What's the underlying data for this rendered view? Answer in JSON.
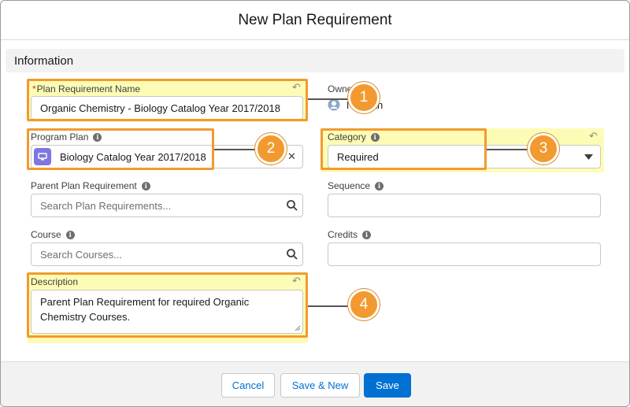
{
  "header": {
    "title": "New Plan Requirement"
  },
  "section": {
    "title": "Information"
  },
  "fields": {
    "plan_requirement_name": {
      "required_marker": "*",
      "label": "Plan Requirement Name",
      "value": "Organic Chemistry - Biology Catalog Year 2017/2018"
    },
    "owner": {
      "label": "Owner",
      "value": "N Smith"
    },
    "program_plan": {
      "label": "Program Plan",
      "value": "Biology Catalog Year 2017/2018",
      "clear_glyph": "✕"
    },
    "category": {
      "label": "Category",
      "value": "Required"
    },
    "parent_plan_requirement": {
      "label": "Parent Plan Requirement",
      "placeholder": "Search Plan Requirements..."
    },
    "sequence": {
      "label": "Sequence",
      "value": ""
    },
    "course": {
      "label": "Course",
      "placeholder": "Search Courses..."
    },
    "credits": {
      "label": "Credits",
      "value": ""
    },
    "description": {
      "label": "Description",
      "value": "Parent Plan Requirement for required Organic Chemistry Courses."
    }
  },
  "callouts": [
    "1",
    "2",
    "3",
    "4"
  ],
  "footer": {
    "cancel": "Cancel",
    "save_new": "Save & New",
    "save": "Save"
  },
  "icons": {
    "info": "i",
    "undo": "↶"
  },
  "colors": {
    "highlight": "#fdfcb6",
    "callout": "#f29a2f",
    "brand": "#0070d2",
    "app_icon": "#7f76e2"
  }
}
